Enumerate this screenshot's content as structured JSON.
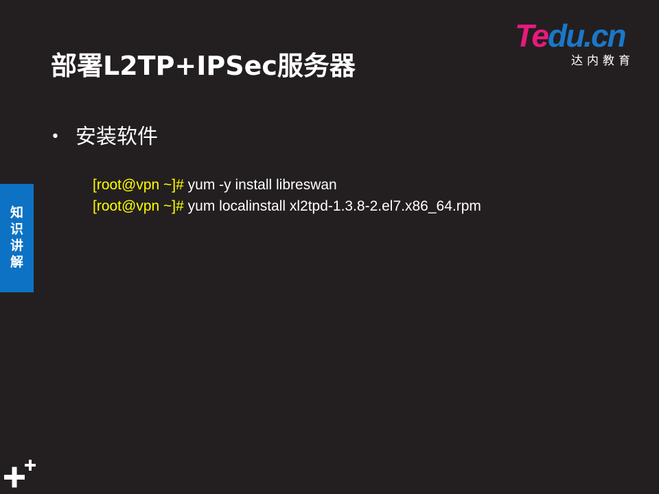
{
  "logo": {
    "brand_te": "Te",
    "brand_du": "du.cn",
    "sub": "达内教育",
    "colors": {
      "pink": "#e8197d",
      "blue": "#1b77c9"
    }
  },
  "slide": {
    "title": "部署L2TP+IPSec服务器",
    "bullet_symbol": "•",
    "bullet": "安装软件",
    "commands": [
      {
        "prompt": "[root@vpn ~]# ",
        "command": "yum -y install libreswan"
      },
      {
        "prompt": "[root@vpn ~]# ",
        "command": "yum localinstall xl2tpd-1.3.8-2.el7.x86_64.rpm"
      }
    ],
    "prompt_color": "#ffff00"
  },
  "side_tab": {
    "chars": [
      "知",
      "识",
      "讲",
      "解"
    ],
    "color": "#0d72c4"
  },
  "icons": {
    "corner": "plus-icon"
  }
}
